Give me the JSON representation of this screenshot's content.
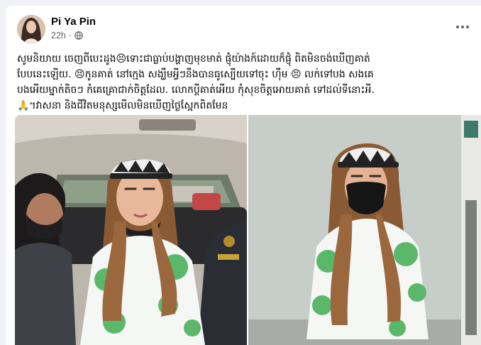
{
  "post": {
    "author_name": "Pi Ya Pin",
    "timestamp": "22h",
    "privacy_icon": "globe-icon",
    "menu_icon": "more-options-icon",
    "caption_lines": [
      "សូមនិយាយ ចេញពីបេះដូង😣ទោះជាធ្លាប់បង្ហាញមុខមាត់ ផ្ញុំយ៉ាងក៍ដោយក៏ផ្ញុំ ពិតមិនចង់ឃើញគាត់",
      "បែបនេះឡើយ. 😣កូនគាត់ នៅក្មេង សង្ឃឹមអ្វីៗនឹងបានធូស្បើយទៅចុះ ហ៊ឹម 😣 លក់ទៅបង សងគេ",
      "បងអើយម្នាក់តិចៗ កំគេគ្រោជាក់ចិត្តដែល. លោកប្តីគាត់អើយ កុំសុខចិត្តអោយគាត់ ទៅដល់ទីនោះអី.",
      "🙏។វាសនា និងជីវិតមនុស្សមើលមិនឃើញថ្ងៃស្អែកពិតមែន"
    ]
  },
  "colors": {
    "page_bg": "#f0f2f5",
    "card_bg": "#ffffff",
    "name": "#050505",
    "meta": "#65676b"
  }
}
